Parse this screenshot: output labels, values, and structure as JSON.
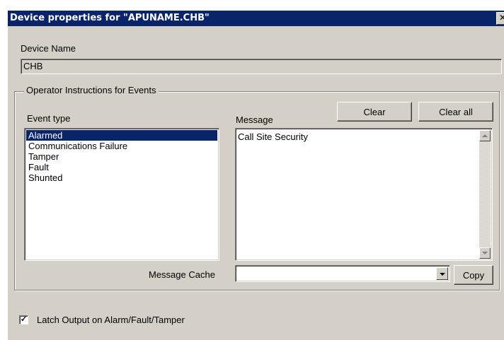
{
  "window": {
    "title": "Device properties for \"APUNAME.CHB\"",
    "close_glyph": "✕"
  },
  "device_name": {
    "label": "Device Name",
    "value": "CHB"
  },
  "operator_instructions": {
    "group_label": "Operator Instructions for Events",
    "event_type_label": "Event type",
    "message_label": "Message",
    "clear_label": "Clear",
    "clear_all_label": "Clear all",
    "event_types": [
      "Alarmed",
      "Communications Failure",
      "Tamper",
      "Fault",
      "Shunted"
    ],
    "selected_event": "Alarmed",
    "message_text": "Call Site Security",
    "message_cache_label": "Message Cache",
    "message_cache_value": "",
    "copy_label": "Copy"
  },
  "latch": {
    "label": "Latch Output on Alarm/Fault/Tamper",
    "checked": true,
    "check_glyph": "✓"
  },
  "colors": {
    "titlebar": "#0a246a",
    "dialog_bg": "#d4d0c8",
    "selection": "#0a246a"
  }
}
